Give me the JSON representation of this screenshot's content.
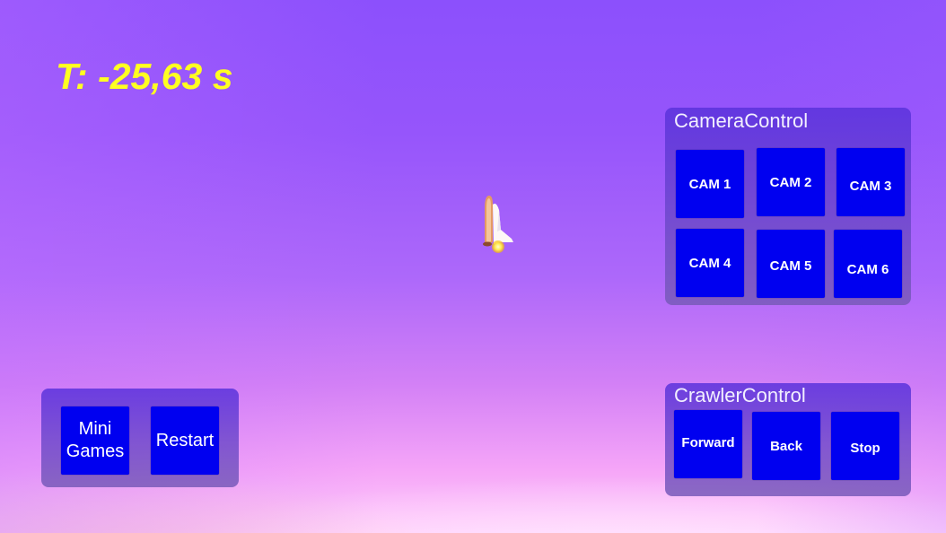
{
  "hud": {
    "timer_text": "T: -25,63 s"
  },
  "colors": {
    "timer": "#ffff22",
    "button_bg": "#0000f0",
    "button_text": "#ffffff",
    "panel_bg": "#5a32dc",
    "sky_top": "#8c50fc",
    "sky_bottom": "#ffcdfb"
  },
  "scene": {
    "object": "space-shuttle-icon"
  },
  "camera_control": {
    "title": "CameraControl",
    "buttons": [
      {
        "label": "CAM 1"
      },
      {
        "label": "CAM 2"
      },
      {
        "label": "CAM 3"
      },
      {
        "label": "CAM 4"
      },
      {
        "label": "CAM 5"
      },
      {
        "label": "CAM 6"
      }
    ]
  },
  "crawler_control": {
    "title": "CrawlerControl",
    "buttons": [
      {
        "label": "Forward"
      },
      {
        "label": "Back"
      },
      {
        "label": "Stop"
      }
    ]
  },
  "game_menu": {
    "buttons": [
      {
        "label": "Mini Games"
      },
      {
        "label": "Restart"
      }
    ]
  }
}
